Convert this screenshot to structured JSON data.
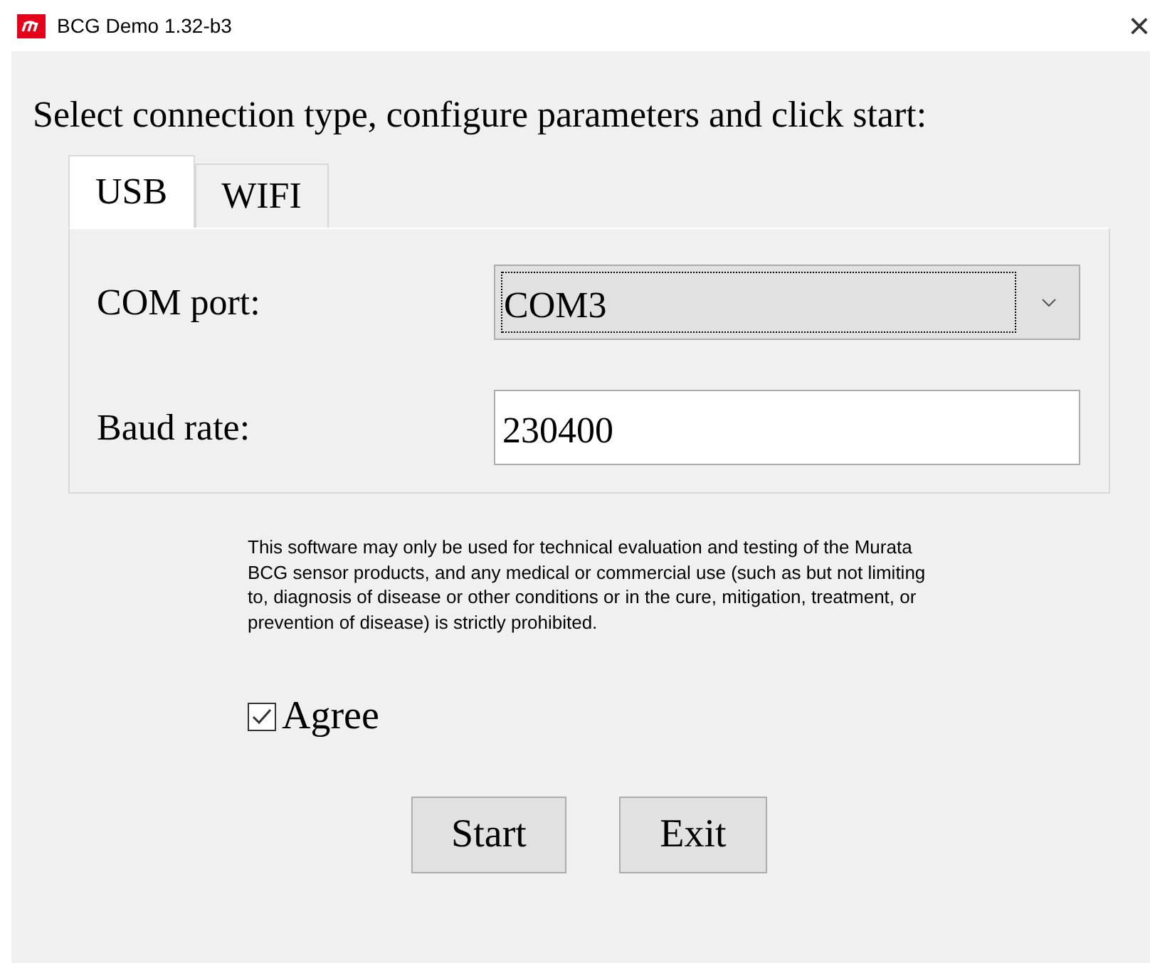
{
  "window": {
    "title": "BCG Demo 1.32-b3",
    "close": "×"
  },
  "heading": "Select connection type, configure parameters and click start:",
  "tabs": [
    {
      "label": "USB",
      "selected": true
    },
    {
      "label": "WIFI",
      "selected": false
    }
  ],
  "fields": [
    {
      "kind": "dropdown",
      "label": "COM port:",
      "value": "COM3",
      "focused": true
    },
    {
      "kind": "text",
      "label": "Baud rate:",
      "value": "230400"
    }
  ],
  "disclaimer": "This software may only be used for technical evaluation and testing of the Murata BCG sensor products, and any medical or commercial use (such as but not limiting to, diagnosis of disease or other conditions or in the cure, mitigation, treatment, or prevention of disease) is strictly prohibited.",
  "agree": {
    "label": "Agree",
    "checked": true
  },
  "buttons": [
    "Start",
    "Exit"
  ]
}
